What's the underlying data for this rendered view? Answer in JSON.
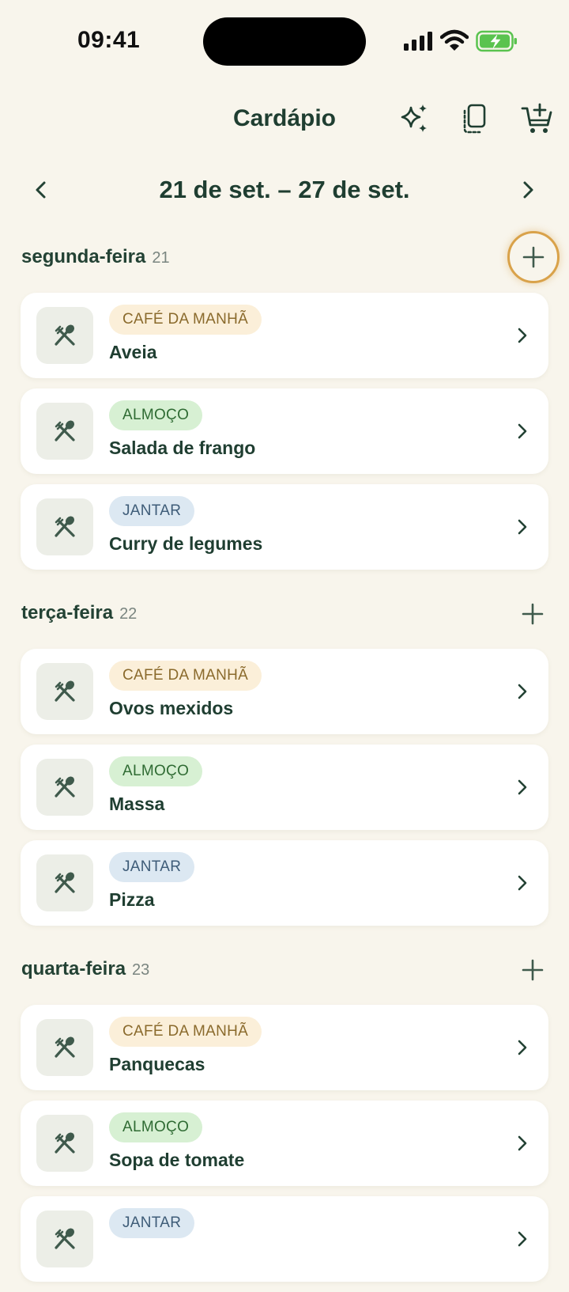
{
  "status": {
    "time": "09:41"
  },
  "header": {
    "title": "Cardápio",
    "icons": [
      "sparkles-icon",
      "copy-icon",
      "cart-add-icon"
    ]
  },
  "week": {
    "label": "21 de set. – 27 de set."
  },
  "days": [
    {
      "name": "segunda-feira",
      "number": "21",
      "meals": [
        {
          "type": "CAFÉ DA MANHÃ",
          "name": "Aveia"
        },
        {
          "type": "ALMOÇO",
          "name": "Salada de frango"
        },
        {
          "type": "JANTAR",
          "name": "Curry de legumes"
        }
      ]
    },
    {
      "name": "terça-feira",
      "number": "22",
      "meals": [
        {
          "type": "CAFÉ DA MANHÃ",
          "name": "Ovos mexidos"
        },
        {
          "type": "ALMOÇO",
          "name": "Massa"
        },
        {
          "type": "JANTAR",
          "name": "Pizza"
        }
      ]
    },
    {
      "name": "quarta-feira",
      "number": "23",
      "meals": [
        {
          "type": "CAFÉ DA MANHÃ",
          "name": "Panquecas"
        },
        {
          "type": "ALMOÇO",
          "name": "Sopa de tomate"
        },
        {
          "type": "JANTAR",
          "name": ""
        }
      ]
    }
  ],
  "colors": {
    "accent": "#1f3e31",
    "highlight_ring": "#d9a24a",
    "background": "#f8f5ec",
    "battery": "#5ac34f"
  }
}
